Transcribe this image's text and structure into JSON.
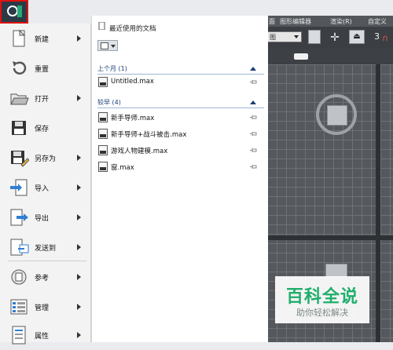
{
  "topbar": {
    "menu_items": [
      "面",
      "图形编辑器",
      "渲染(R)",
      "自定义"
    ],
    "view_dropdown": "图",
    "toolbar_number": "3"
  },
  "left_menu": {
    "items": [
      {
        "label": "新建",
        "icon": "new-document-icon",
        "has_submenu": true
      },
      {
        "label": "重置",
        "icon": "reset-icon",
        "has_submenu": false
      },
      {
        "label": "打开",
        "icon": "open-folder-icon",
        "has_submenu": true
      },
      {
        "label": "保存",
        "icon": "save-icon",
        "has_submenu": false
      },
      {
        "label": "另存为",
        "icon": "save-as-icon",
        "has_submenu": true
      },
      {
        "label": "导入",
        "icon": "import-icon",
        "has_submenu": true
      },
      {
        "label": "导出",
        "icon": "export-icon",
        "has_submenu": true
      },
      {
        "label": "发送到",
        "icon": "send-to-icon",
        "has_submenu": true
      },
      {
        "label": "参考",
        "icon": "reference-icon",
        "has_submenu": true
      },
      {
        "label": "管理",
        "icon": "manage-icon",
        "has_submenu": true
      },
      {
        "label": "属性",
        "icon": "properties-icon",
        "has_submenu": true
      }
    ]
  },
  "recent": {
    "title": "最近使用的文档",
    "groups": [
      {
        "header": "上个月 (1)",
        "files": [
          "Untitled.max"
        ]
      },
      {
        "header": "较早 (4)",
        "files": [
          "新手导师.max",
          "新手导师+战斗被击.max",
          "游戏人物建模.max",
          "窗.max"
        ]
      }
    ]
  },
  "watermark": {
    "title": "百科全说",
    "subtitle": "助你轻松解决"
  },
  "colors": {
    "highlight_border": "#e01010",
    "group_header": "#1b3f79",
    "watermark_green": "#1fae6b",
    "viewport_bg": "#55595d"
  }
}
